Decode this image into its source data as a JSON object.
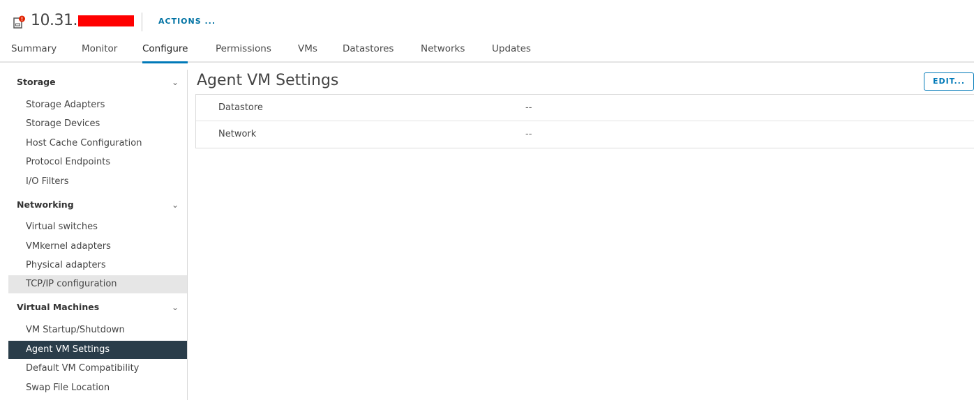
{
  "header": {
    "host_name_prefix": "10.31.",
    "actions_label": "ACTIONS ...",
    "host_icon": "host-alert-icon"
  },
  "tabs": [
    {
      "label": "Summary"
    },
    {
      "label": "Monitor"
    },
    {
      "label": "Configure",
      "active": true
    },
    {
      "label": "Permissions"
    },
    {
      "label": "VMs"
    },
    {
      "label": "Datastores"
    },
    {
      "label": "Networks"
    },
    {
      "label": "Updates"
    }
  ],
  "sidebar": {
    "sections": [
      {
        "title": "Storage",
        "items": [
          "Storage Adapters",
          "Storage Devices",
          "Host Cache Configuration",
          "Protocol Endpoints",
          "I/O Filters"
        ]
      },
      {
        "title": "Networking",
        "items": [
          "Virtual switches",
          "VMkernel adapters",
          "Physical adapters",
          "TCP/IP configuration"
        ]
      },
      {
        "title": "Virtual Machines",
        "items": [
          "VM Startup/Shutdown",
          "Agent VM Settings",
          "Default VM Compatibility",
          "Swap File Location"
        ]
      }
    ],
    "selected_item": "Agent VM Settings",
    "hovered_item": "TCP/IP configuration"
  },
  "main": {
    "title": "Agent VM Settings",
    "edit_label": "EDIT...",
    "rows": [
      {
        "label": "Datastore",
        "value": "--"
      },
      {
        "label": "Network",
        "value": "--"
      }
    ]
  },
  "colors": {
    "accent": "#0079b8",
    "selected_bg": "#2a3d4a",
    "alert": "#e12200"
  }
}
